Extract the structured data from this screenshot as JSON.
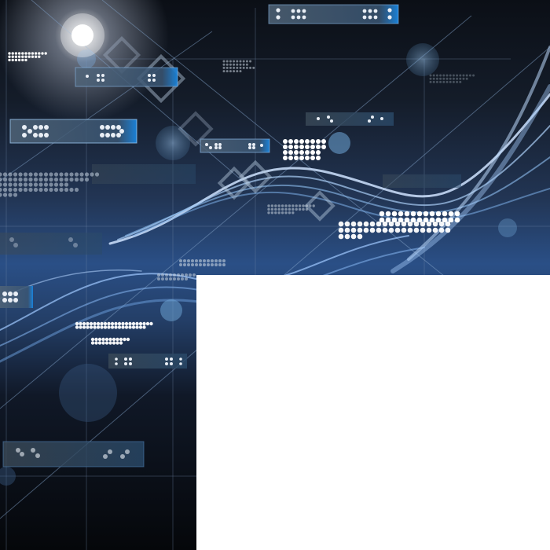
{
  "artwork": {
    "kind": "abstract technology background",
    "colors": {
      "background_top": "#0b0f16",
      "background_mid": "#2a4f86",
      "background_bottom": "#05070a",
      "wave_light": "#9fc9ff",
      "panel_fill": "#3f5c7a",
      "panel_accent": "#1d8de6",
      "blank_panel": "#ffffff"
    },
    "elements": [
      "glow-light",
      "light-waves",
      "diagonal-lines",
      "grid-lines",
      "translucent-circles",
      "diamond-outlines",
      "button-bar-panels",
      "dot-matrix-patterns"
    ]
  }
}
